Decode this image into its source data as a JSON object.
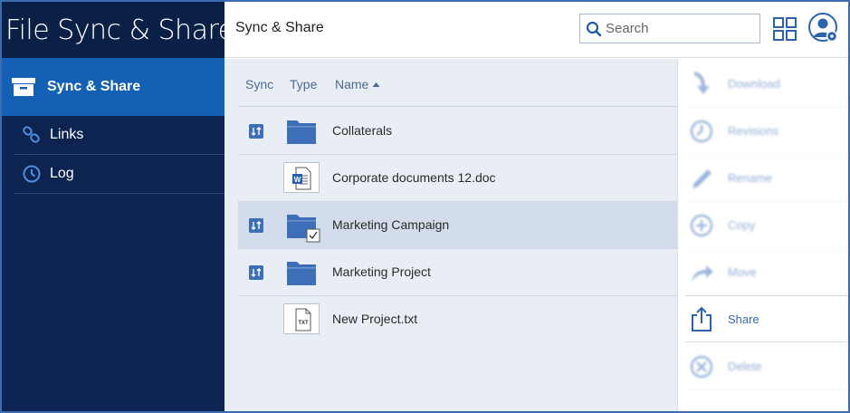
{
  "brand": "File Sync & Share",
  "sidebar": {
    "active": {
      "label": "Sync & Share",
      "icon": "archive-box-icon"
    },
    "items": [
      {
        "label": "Links",
        "icon": "link-icon"
      },
      {
        "label": "Log",
        "icon": "clock-icon"
      }
    ]
  },
  "header": {
    "title": "Sync & Share",
    "search_placeholder": "Search",
    "icons": [
      "grid-view-icon",
      "user-avatar-icon"
    ]
  },
  "list": {
    "columns": {
      "sync": "Sync",
      "type": "Type",
      "name": "Name"
    },
    "sort": "name-ascending",
    "rows": [
      {
        "name": "Collaterals",
        "type": "folder",
        "synced": true,
        "selected": false
      },
      {
        "name": "Corporate documents 12.doc",
        "type": "word-document",
        "synced": false,
        "selected": false
      },
      {
        "name": "Marketing Campaign",
        "type": "folder",
        "synced": true,
        "selected": true
      },
      {
        "name": "Marketing Project",
        "type": "folder",
        "synced": true,
        "selected": false
      },
      {
        "name": "New Project.txt",
        "type": "text-file",
        "synced": false,
        "selected": false
      }
    ],
    "type_badge_txt": "TXT",
    "type_badge_word": "W"
  },
  "actions": [
    {
      "label": "Download",
      "icon": "download-icon",
      "enabled": false
    },
    {
      "label": "Revisions",
      "icon": "revisions-icon",
      "enabled": false
    },
    {
      "label": "Rename",
      "icon": "pencil-icon",
      "enabled": false
    },
    {
      "label": "Copy",
      "icon": "copy-plus-icon",
      "enabled": false
    },
    {
      "label": "Move",
      "icon": "move-arrow-icon",
      "enabled": false
    },
    {
      "label": "Share",
      "icon": "share-icon",
      "enabled": true
    },
    {
      "label": "Delete",
      "icon": "delete-icon",
      "enabled": false
    }
  ],
  "colors": {
    "sidebar": "#0d2450",
    "active_nav": "#1360b4",
    "accent": "#3a6bb3",
    "list_bg": "#e9eef5",
    "selected_row": "#d2dcea"
  }
}
